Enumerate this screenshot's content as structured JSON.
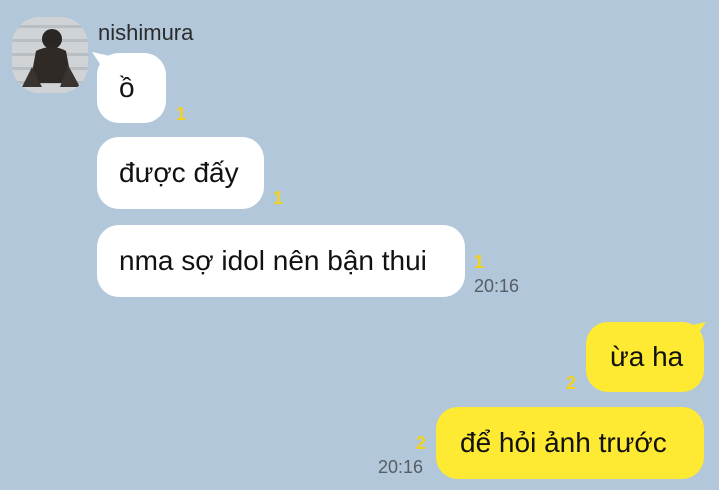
{
  "chat": {
    "sender_name": "nishimura",
    "incoming": [
      {
        "text": "ồ",
        "unread": "1"
      },
      {
        "text": "được đấy",
        "unread": "1"
      },
      {
        "text": "nma sợ idol nên bận thui",
        "unread": "1",
        "time": "20:16"
      }
    ],
    "outgoing": [
      {
        "text": "ừa ha",
        "unread": "2"
      },
      {
        "text": "để hỏi ảnh trước",
        "unread": "2",
        "time": "20:16"
      }
    ]
  },
  "colors": {
    "background": "#b2c7d9",
    "incoming_bubble": "#ffffff",
    "outgoing_bubble": "#fee933",
    "unread_count": "#f2d21b"
  }
}
